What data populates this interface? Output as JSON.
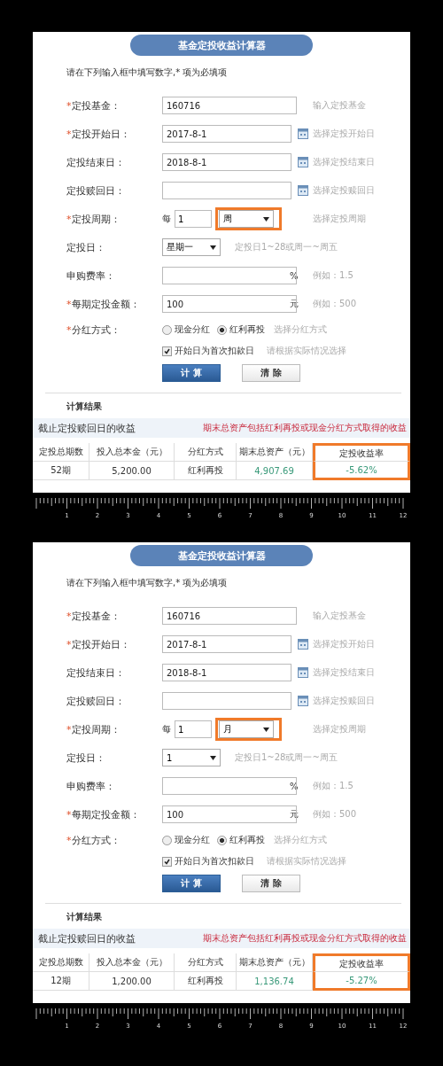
{
  "panels": [
    {
      "title": "基金定投收益计算器",
      "instruction": "请在下列输入框中填写数字,* 项为必填项",
      "fields": [
        {
          "kind": "text",
          "required_mark": "*",
          "label": "定投基金：",
          "value": "160716",
          "hint": "输入定投基金"
        },
        {
          "kind": "date",
          "required_mark": "*",
          "label": "定投开始日：",
          "value": "2017-8-1",
          "hint": "选择定投开始日"
        },
        {
          "kind": "date",
          "label": "定投结束日：",
          "value": "2018-8-1",
          "hint": "选择定投结束日"
        },
        {
          "kind": "date",
          "label": "定投赎回日：",
          "hint": "选择定投赎回日"
        },
        {
          "kind": "period",
          "required_mark": "*",
          "label": "定投周期：",
          "prefix": "每",
          "value": "1",
          "choice": "周",
          "highlighted": true,
          "hint": "选择定投周期"
        },
        {
          "kind": "select",
          "label": "定投日：",
          "choice": "星期一",
          "hint": "定投日1~28或周一~周五"
        },
        {
          "kind": "text",
          "label": "申购费率：",
          "unit": "%",
          "hint": "例如：1.5"
        },
        {
          "kind": "text",
          "required_mark": "*",
          "label": "每期定投金额：",
          "value": "100",
          "unit": "元",
          "hint": "例如：500"
        },
        {
          "kind": "radio",
          "required_mark": "*",
          "label": "分红方式：",
          "options": [
            {
              "label": "现金分红",
              "selected": false
            },
            {
              "label": "红利再投",
              "selected": true
            }
          ],
          "hint": "选择分红方式"
        },
        {
          "kind": "checkbox",
          "option": "开始日为首次扣款日",
          "checked": true,
          "hint": "请根据实际情况选择"
        }
      ],
      "buttons": [
        {
          "kind": "primary",
          "label": "计 算"
        },
        {
          "kind": "secondary",
          "label": "清 除"
        }
      ],
      "results": {
        "heading": "计算结果",
        "subtitle": "截止定投赎回日的收益",
        "note": "期末总资产包括红利再投或现金分红方式取得的收益",
        "columns": [
          {
            "label": "定投总期数",
            "highlighted": false
          },
          {
            "label": "投入总本金（元）",
            "highlighted": false
          },
          {
            "label": "分红方式",
            "highlighted": false
          },
          {
            "label": "期末总资产（元）",
            "highlighted": false
          },
          {
            "label": "定投收益率",
            "highlighted": true
          }
        ],
        "row": [
          "52期",
          "5,200.00",
          "红利再投",
          "4,907.69",
          "-5.62%"
        ]
      },
      "ruler": [
        "1",
        "2",
        "3",
        "4",
        "5",
        "6",
        "7",
        "8",
        "9",
        "10",
        "11",
        "12"
      ]
    },
    {
      "title": "基金定投收益计算器",
      "instruction": "请在下列输入框中填写数字,* 项为必填项",
      "fields": [
        {
          "kind": "text",
          "required_mark": "*",
          "label": "定投基金：",
          "value": "160716",
          "hint": "输入定投基金"
        },
        {
          "kind": "date",
          "required_mark": "*",
          "label": "定投开始日：",
          "value": "2017-8-1",
          "hint": "选择定投开始日"
        },
        {
          "kind": "date",
          "label": "定投结束日：",
          "value": "2018-8-1",
          "hint": "选择定投结束日"
        },
        {
          "kind": "date",
          "label": "定投赎回日：",
          "hint": "选择定投赎回日"
        },
        {
          "kind": "period",
          "required_mark": "*",
          "label": "定投周期：",
          "prefix": "每",
          "value": "1",
          "choice": "月",
          "highlighted": true,
          "hint": "选择定投周期"
        },
        {
          "kind": "select",
          "label": "定投日：",
          "choice": "1",
          "highlighted": false,
          "hint": "定投日1~28或周一~周五"
        },
        {
          "kind": "text",
          "label": "申购费率：",
          "unit": "%",
          "hint": "例如：1.5"
        },
        {
          "kind": "text",
          "required_mark": "*",
          "label": "每期定投金额：",
          "value": "100",
          "unit": "元",
          "hint": "例如：500"
        },
        {
          "kind": "radio",
          "required_mark": "*",
          "label": "分红方式：",
          "options": [
            {
              "label": "现金分红",
              "selected": false
            },
            {
              "label": "红利再投",
              "selected": true
            }
          ],
          "hint": "选择分红方式"
        },
        {
          "kind": "checkbox",
          "option": "开始日为首次扣款日",
          "checked": true,
          "hint": "请根据实际情况选择"
        }
      ],
      "buttons": [
        {
          "kind": "primary",
          "label": "计 算"
        },
        {
          "kind": "secondary",
          "label": "清 除"
        }
      ],
      "results": {
        "heading": "计算结果",
        "subtitle": "截止定投赎回日的收益",
        "note": "期末总资产包括红利再投或现金分红方式取得的收益",
        "columns": [
          {
            "label": "定投总期数",
            "highlighted": false
          },
          {
            "label": "投入总本金（元）",
            "highlighted": false
          },
          {
            "label": "分红方式",
            "highlighted": false
          },
          {
            "label": "期末总资产（元）",
            "highlighted": false
          },
          {
            "label": "定投收益率",
            "highlighted": true
          }
        ],
        "row": [
          "12期",
          "1,200.00",
          "红利再投",
          "1,136.74",
          "-5.27%"
        ]
      },
      "ruler": [
        "1",
        "2",
        "3",
        "4",
        "5",
        "6",
        "7",
        "8",
        "9",
        "10",
        "11",
        "12"
      ]
    }
  ]
}
